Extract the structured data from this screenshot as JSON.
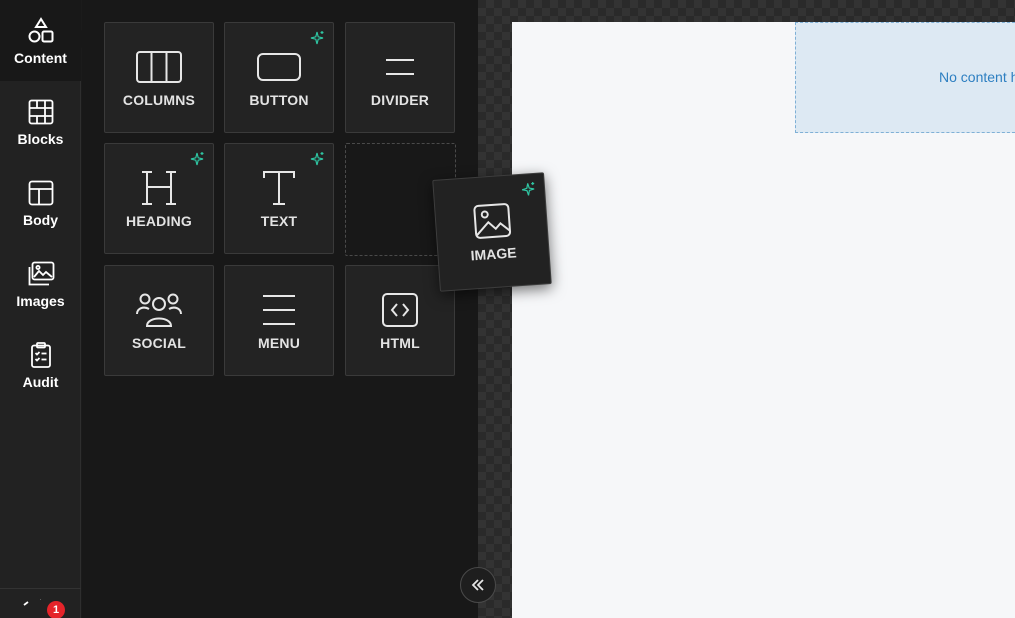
{
  "sidebar": {
    "items": [
      {
        "label": "Content",
        "icon": "shapes-icon"
      },
      {
        "label": "Blocks",
        "icon": "blocks-grid-icon"
      },
      {
        "label": "Body",
        "icon": "layout-icon"
      },
      {
        "label": "Images",
        "icon": "images-icon"
      },
      {
        "label": "Audit",
        "icon": "clipboard-check-icon"
      }
    ],
    "notification_count": "1"
  },
  "tools": [
    {
      "label": "COLUMNS",
      "icon": "columns-icon",
      "ai": false
    },
    {
      "label": "BUTTON",
      "icon": "button-icon",
      "ai": true
    },
    {
      "label": "DIVIDER",
      "icon": "divider-icon",
      "ai": false
    },
    {
      "label": "HEADING",
      "icon": "heading-icon",
      "ai": true
    },
    {
      "label": "TEXT",
      "icon": "text-icon",
      "ai": true
    },
    {
      "label": "SOCIAL",
      "icon": "social-icon",
      "ai": false
    },
    {
      "label": "MENU",
      "icon": "menu-icon",
      "ai": false
    },
    {
      "label": "HTML",
      "icon": "html-code-icon",
      "ai": false
    }
  ],
  "dragging": {
    "label": "IMAGE",
    "icon": "image-icon",
    "ai": true
  },
  "canvas": {
    "empty_text": "No content here. Drag content from right."
  },
  "colors": {
    "accent_ai": "#2fc5a2",
    "badge": "#e5242a",
    "placeholder_text": "#2d7fc1"
  }
}
